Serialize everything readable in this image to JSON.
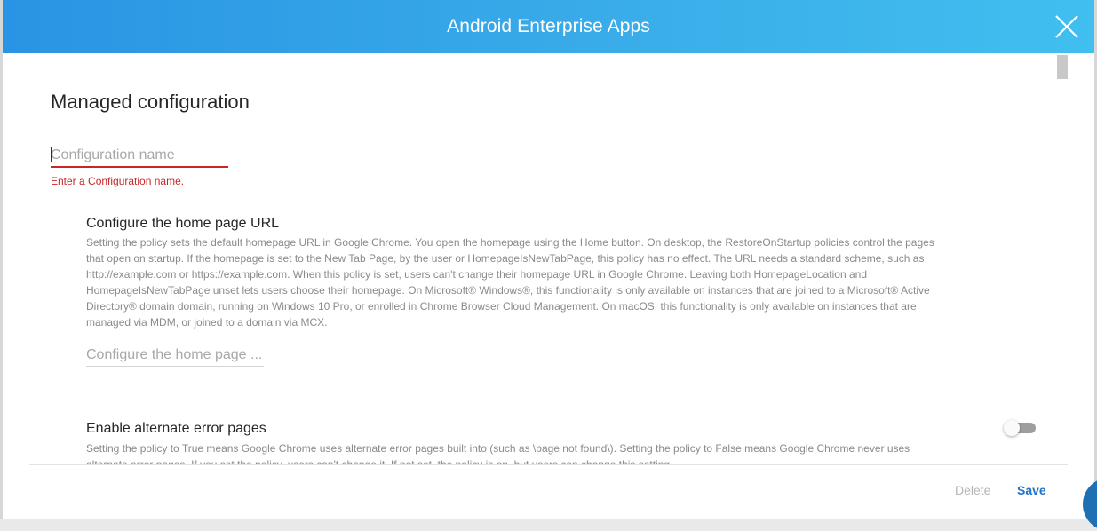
{
  "header": {
    "title": "Android Enterprise Apps"
  },
  "form": {
    "title": "Managed configuration",
    "config_name_placeholder": "Configuration name",
    "config_name_value": "",
    "config_name_error": "Enter a Configuration name."
  },
  "sections": [
    {
      "title": "Configure the home page URL",
      "description": "Setting the policy sets the default homepage URL in Google Chrome. You open the homepage using the Home button. On desktop, the RestoreOnStartup policies control the pages that open on startup. If the homepage is set to the New Tab Page, by the user or HomepageIsNewTabPage, this policy has no effect. The URL needs a standard scheme, such as http://example.com or https://example.com. When this policy is set, users can't change their homepage URL in Google Chrome. Leaving both HomepageLocation and HomepageIsNewTabPage unset lets users choose their homepage. On Microsoft® Windows®, this functionality is only available on instances that are joined to a Microsoft® Active Directory® domain domain, running on Windows 10 Pro, or enrolled in Chrome Browser Cloud Management. On macOS, this functionality is only available on instances that are managed via MDM, or joined to a domain via MCX.",
      "input_placeholder": "Configure the home page ..."
    },
    {
      "title": "Enable alternate error pages",
      "description": "Setting the policy to True means Google Chrome uses alternate error pages built into (such as \\page not found\\). Setting the policy to False means Google Chrome never uses alternate error pages. If you set the policy, users can't change it. If not set, the policy is on, but users can change this setting.",
      "toggle_on": false
    }
  ],
  "footer": {
    "delete_label": "Delete",
    "save_label": "Save"
  },
  "colors": {
    "header_start": "#2a94e4",
    "header_end": "#41bff0",
    "error": "#c62828",
    "primary": "#1e73c8"
  },
  "icons": {
    "close": "close-icon"
  }
}
